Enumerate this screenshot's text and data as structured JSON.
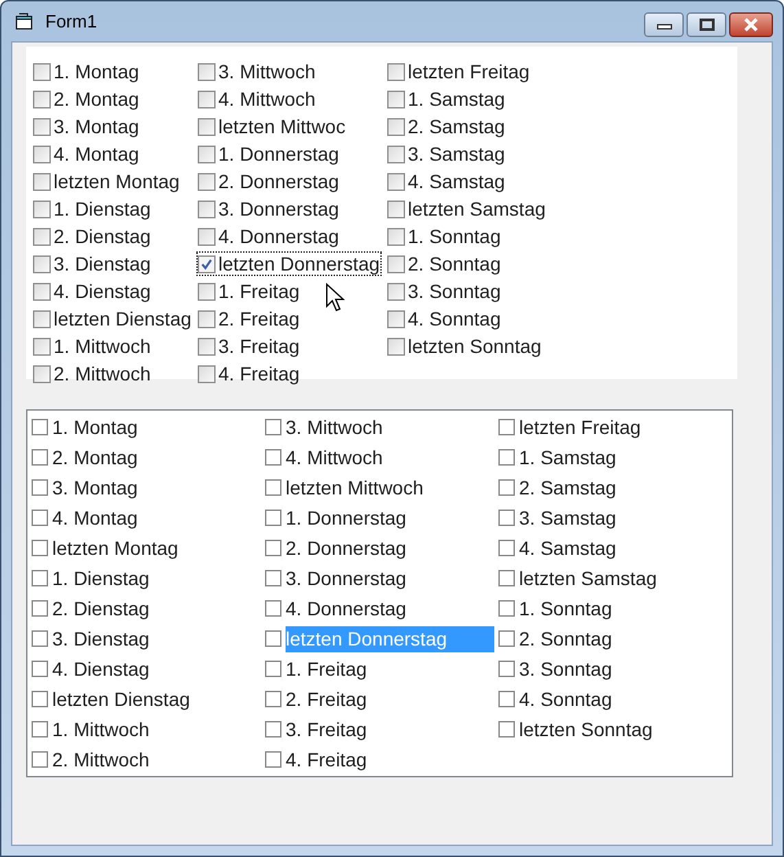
{
  "window": {
    "title": "Form1"
  },
  "checkbox_panel": {
    "items": [
      {
        "label": "1. Montag",
        "checked": false,
        "focused": false
      },
      {
        "label": "2. Montag",
        "checked": false,
        "focused": false
      },
      {
        "label": "3. Montag",
        "checked": false,
        "focused": false
      },
      {
        "label": "4. Montag",
        "checked": false,
        "focused": false
      },
      {
        "label": "letzten Montag",
        "checked": false,
        "focused": false
      },
      {
        "label": "1. Dienstag",
        "checked": false,
        "focused": false
      },
      {
        "label": "2. Dienstag",
        "checked": false,
        "focused": false
      },
      {
        "label": "3. Dienstag",
        "checked": false,
        "focused": false
      },
      {
        "label": "4. Dienstag",
        "checked": false,
        "focused": false
      },
      {
        "label": "letzten Dienstag",
        "checked": false,
        "focused": false
      },
      {
        "label": "1. Mittwoch",
        "checked": false,
        "focused": false
      },
      {
        "label": "2. Mittwoch",
        "checked": false,
        "focused": false
      },
      {
        "label": "3. Mittwoch",
        "checked": false,
        "focused": false
      },
      {
        "label": "4. Mittwoch",
        "checked": false,
        "focused": false
      },
      {
        "label": "letzten Mittwoc",
        "checked": false,
        "focused": false
      },
      {
        "label": "1. Donnerstag",
        "checked": false,
        "focused": false
      },
      {
        "label": "2. Donnerstag",
        "checked": false,
        "focused": false
      },
      {
        "label": "3. Donnerstag",
        "checked": false,
        "focused": false
      },
      {
        "label": "4. Donnerstag",
        "checked": false,
        "focused": false
      },
      {
        "label": "letzten Donnerstag",
        "checked": true,
        "focused": true
      },
      {
        "label": "1. Freitag",
        "checked": false,
        "focused": false
      },
      {
        "label": "2. Freitag",
        "checked": false,
        "focused": false
      },
      {
        "label": "3. Freitag",
        "checked": false,
        "focused": false
      },
      {
        "label": "4. Freitag",
        "checked": false,
        "focused": false
      },
      {
        "label": "letzten Freitag",
        "checked": false,
        "focused": false
      },
      {
        "label": "1. Samstag",
        "checked": false,
        "focused": false
      },
      {
        "label": "2. Samstag",
        "checked": false,
        "focused": false
      },
      {
        "label": "3. Samstag",
        "checked": false,
        "focused": false
      },
      {
        "label": "4. Samstag",
        "checked": false,
        "focused": false
      },
      {
        "label": "letzten Samstag",
        "checked": false,
        "focused": false
      },
      {
        "label": "1. Sonntag",
        "checked": false,
        "focused": false
      },
      {
        "label": "2. Sonntag",
        "checked": false,
        "focused": false
      },
      {
        "label": "3. Sonntag",
        "checked": false,
        "focused": false
      },
      {
        "label": "4. Sonntag",
        "checked": false,
        "focused": false
      },
      {
        "label": "letzten Sonntag",
        "checked": false,
        "focused": false
      }
    ]
  },
  "checked_list": {
    "items": [
      {
        "label": "1. Montag",
        "checked": false,
        "selected": false
      },
      {
        "label": "2. Montag",
        "checked": false,
        "selected": false
      },
      {
        "label": "3. Montag",
        "checked": false,
        "selected": false
      },
      {
        "label": "4. Montag",
        "checked": false,
        "selected": false
      },
      {
        "label": "letzten Montag",
        "checked": false,
        "selected": false
      },
      {
        "label": "1. Dienstag",
        "checked": false,
        "selected": false
      },
      {
        "label": "2. Dienstag",
        "checked": false,
        "selected": false
      },
      {
        "label": "3. Dienstag",
        "checked": false,
        "selected": false
      },
      {
        "label": "4. Dienstag",
        "checked": false,
        "selected": false
      },
      {
        "label": "letzten Dienstag",
        "checked": false,
        "selected": false
      },
      {
        "label": "1. Mittwoch",
        "checked": false,
        "selected": false
      },
      {
        "label": "2. Mittwoch",
        "checked": false,
        "selected": false
      },
      {
        "label": "3. Mittwoch",
        "checked": false,
        "selected": false
      },
      {
        "label": "4. Mittwoch",
        "checked": false,
        "selected": false
      },
      {
        "label": "letzten Mittwoch",
        "checked": false,
        "selected": false
      },
      {
        "label": "1. Donnerstag",
        "checked": false,
        "selected": false
      },
      {
        "label": "2. Donnerstag",
        "checked": false,
        "selected": false
      },
      {
        "label": "3. Donnerstag",
        "checked": false,
        "selected": false
      },
      {
        "label": "4. Donnerstag",
        "checked": false,
        "selected": false
      },
      {
        "label": "letzten Donnerstag",
        "checked": false,
        "selected": true
      },
      {
        "label": "1. Freitag",
        "checked": false,
        "selected": false
      },
      {
        "label": "2. Freitag",
        "checked": false,
        "selected": false
      },
      {
        "label": "3. Freitag",
        "checked": false,
        "selected": false
      },
      {
        "label": "4. Freitag",
        "checked": false,
        "selected": false
      },
      {
        "label": "letzten Freitag",
        "checked": false,
        "selected": false
      },
      {
        "label": "1. Samstag",
        "checked": false,
        "selected": false
      },
      {
        "label": "2. Samstag",
        "checked": false,
        "selected": false
      },
      {
        "label": "3. Samstag",
        "checked": false,
        "selected": false
      },
      {
        "label": "4. Samstag",
        "checked": false,
        "selected": false
      },
      {
        "label": "letzten Samstag",
        "checked": false,
        "selected": false
      },
      {
        "label": "1. Sonntag",
        "checked": false,
        "selected": false
      },
      {
        "label": "2. Sonntag",
        "checked": false,
        "selected": false
      },
      {
        "label": "3. Sonntag",
        "checked": false,
        "selected": false
      },
      {
        "label": "4. Sonntag",
        "checked": false,
        "selected": false
      },
      {
        "label": "letzten Sonntag",
        "checked": false,
        "selected": false
      }
    ]
  }
}
